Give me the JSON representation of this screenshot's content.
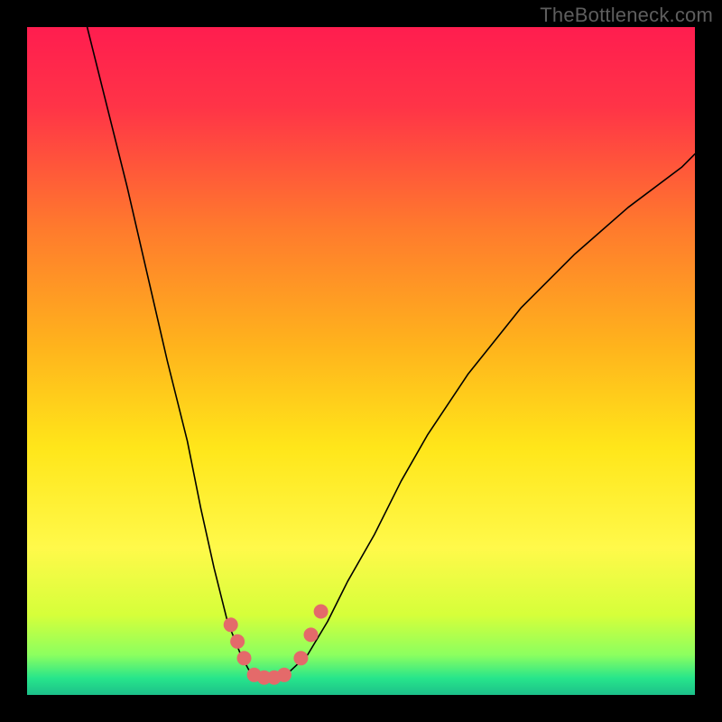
{
  "watermark": "TheBottleneck.com",
  "chart_data": {
    "type": "line",
    "title": "",
    "xlabel": "",
    "ylabel": "",
    "xlim": [
      0,
      100
    ],
    "ylim": [
      0,
      100
    ],
    "grid": false,
    "legend": false,
    "background_gradient": {
      "stops": [
        {
          "pos": 0.0,
          "color": "#ff1d4f"
        },
        {
          "pos": 0.12,
          "color": "#ff3447"
        },
        {
          "pos": 0.3,
          "color": "#ff7a2d"
        },
        {
          "pos": 0.48,
          "color": "#ffb41c"
        },
        {
          "pos": 0.63,
          "color": "#ffe61a"
        },
        {
          "pos": 0.78,
          "color": "#fff94a"
        },
        {
          "pos": 0.88,
          "color": "#d6ff3a"
        },
        {
          "pos": 0.94,
          "color": "#8cff5f"
        },
        {
          "pos": 0.975,
          "color": "#27e58b"
        },
        {
          "pos": 1.0,
          "color": "#1cc08a"
        }
      ]
    },
    "series": [
      {
        "name": "bottleneck-curve",
        "stroke": "#000000",
        "stroke_width": 1.6,
        "x": [
          9,
          12,
          15,
          18,
          21,
          24,
          26,
          28,
          30,
          32,
          33.5,
          35,
          37,
          39,
          42,
          45,
          48,
          52,
          56,
          60,
          66,
          74,
          82,
          90,
          98,
          100
        ],
        "y": [
          100,
          88,
          76,
          63,
          50,
          38,
          28,
          19,
          11,
          6,
          3.2,
          2.7,
          2.7,
          3.2,
          6,
          11,
          17,
          24,
          32,
          39,
          48,
          58,
          66,
          73,
          79,
          81
        ]
      }
    ],
    "markers": {
      "name": "highlight-points",
      "color": "#e46a6a",
      "radius": 8,
      "points": [
        {
          "x": 30.5,
          "y": 10.5
        },
        {
          "x": 31.5,
          "y": 8.0
        },
        {
          "x": 32.5,
          "y": 5.5
        },
        {
          "x": 34.0,
          "y": 3.0
        },
        {
          "x": 35.5,
          "y": 2.6
        },
        {
          "x": 37.0,
          "y": 2.6
        },
        {
          "x": 38.5,
          "y": 3.0
        },
        {
          "x": 41.0,
          "y": 5.5
        },
        {
          "x": 42.5,
          "y": 9.0
        },
        {
          "x": 44.0,
          "y": 12.5
        }
      ]
    }
  }
}
